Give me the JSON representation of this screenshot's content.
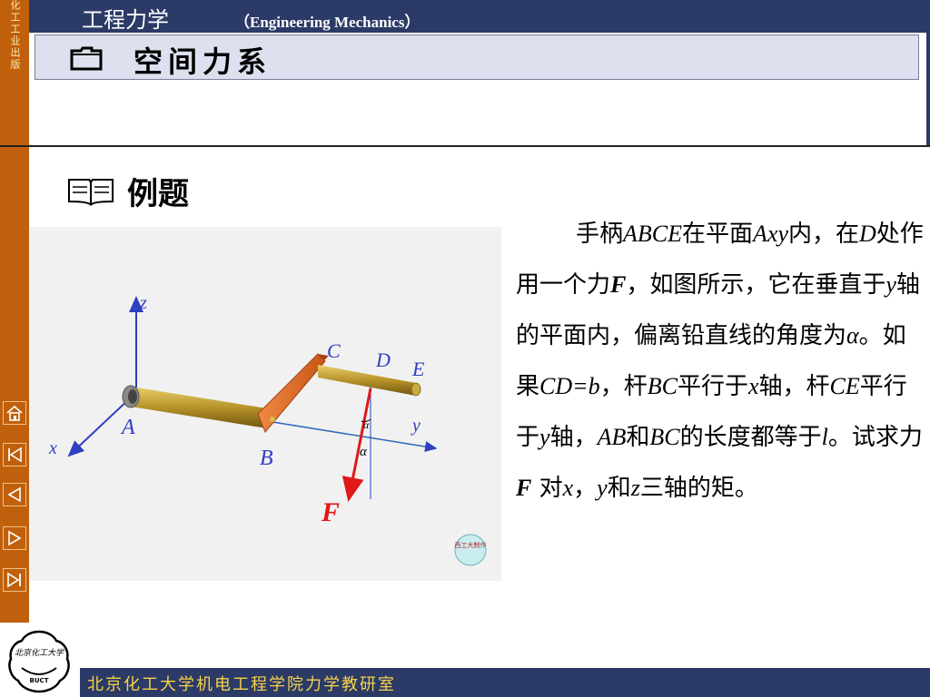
{
  "header": {
    "course_title": "工程力学",
    "course_en": "（Engineering Mechanics）",
    "publisher_vertical": "化工工业出版"
  },
  "section": {
    "title": "空间力系",
    "icon": "folder-icon"
  },
  "example": {
    "title": "例题",
    "icon": "book-icon"
  },
  "figure": {
    "labels": {
      "z": "z",
      "x": "x",
      "y": "y",
      "A": "A",
      "B": "B",
      "C": "C",
      "D": "D",
      "E": "E",
      "F": "F",
      "alpha_near_F": "α",
      "alpha_lower": "α",
      "stamp": "西工大制作"
    }
  },
  "problem": {
    "p1": "手柄",
    "p2": "ABCE",
    "p3": "在平面",
    "p4": "Axy",
    "p5": "内，在",
    "p6": "D",
    "p7": "处作用一个力",
    "p8": "F",
    "p9": "，如图所示，它在垂直于",
    "p10": "y",
    "p11": "轴的平面内，偏离铅直线的角度为",
    "p12": "α",
    "p13": "。如果",
    "p14": "CD=b",
    "p15": "，杆",
    "p16": "BC",
    "p17": "平行于",
    "p18": "x",
    "p19": "轴，杆",
    "p20": "CE",
    "p21": "平行于",
    "p22": "y",
    "p23": "轴，",
    "p24": "AB",
    "p25": "和",
    "p26": "BC",
    "p27": "的长度都等于",
    "p28": "l",
    "p29": "。试求力",
    "p30": "F",
    "p31": " 对",
    "p32": "x",
    "p33": "，",
    "p34": "y",
    "p35": "和",
    "p36": "z",
    "p37": "三轴的矩。"
  },
  "nav": {
    "home": "home-icon",
    "first": "first-page-icon",
    "prev": "previous-icon",
    "next": "next-icon",
    "last": "last-page-icon"
  },
  "footer": {
    "text": "北京化工大学机电工程学院力学教研室",
    "logo_text": "BUCT"
  },
  "colors": {
    "orange_bar": "#c0600c",
    "navy": "#2b3a66",
    "footer_text": "#f6d24a"
  }
}
